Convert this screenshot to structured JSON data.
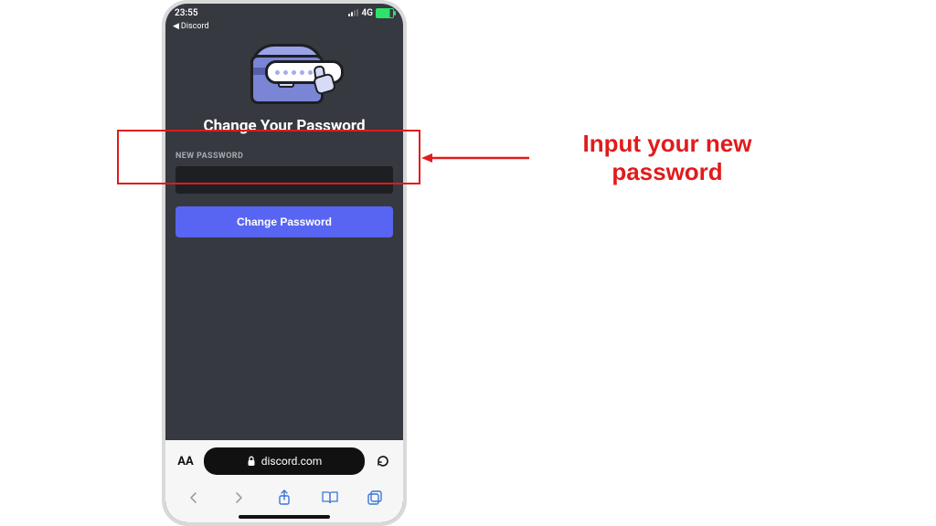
{
  "status_bar": {
    "time": "23:55",
    "network_label": "4G"
  },
  "back_app": {
    "label": "Discord"
  },
  "page": {
    "heading": "Change Your Password",
    "field_label": "NEW PASSWORD",
    "input_value": "",
    "input_placeholder": "",
    "submit_label": "Change Password"
  },
  "browser": {
    "domain": "discord.com",
    "text_size_label": "AA"
  },
  "annotation": {
    "line1": "Input your new",
    "line2": "password"
  },
  "icons": {
    "lock": "lock"
  },
  "colors": {
    "accent": "#5865f2",
    "callout": "#e11b1b"
  }
}
